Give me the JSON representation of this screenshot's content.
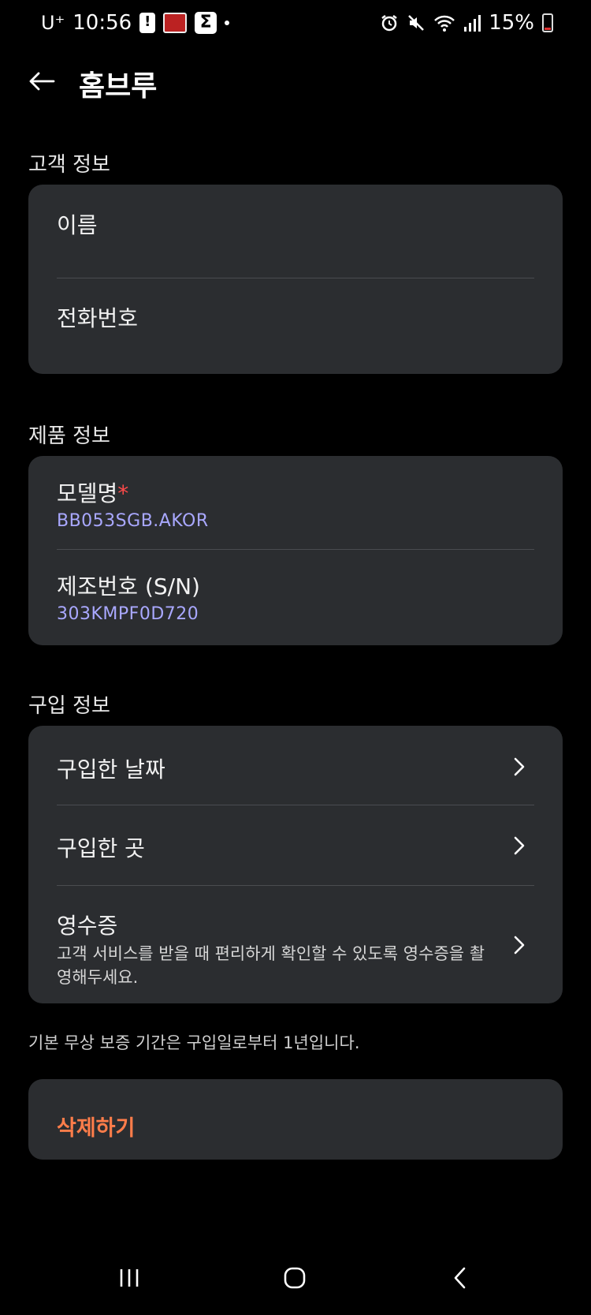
{
  "status_bar": {
    "carrier": "U⁺",
    "time": "10:56",
    "battery": "15%"
  },
  "header": {
    "title": "홈브루"
  },
  "customer": {
    "section_title": "고객 정보",
    "name_label": "이름",
    "phone_label": "전화번호"
  },
  "product": {
    "section_title": "제품 정보",
    "model_label": "모델명",
    "model_required_mark": "*",
    "model_value": "BB053SGB.AKOR",
    "serial_label": "제조번호 (S/N)",
    "serial_value": "303KMPF0D720"
  },
  "purchase": {
    "section_title": "구입 정보",
    "date_label": "구입한 날짜",
    "place_label": "구입한 곳",
    "receipt_label": "영수증",
    "receipt_desc": "고객 서비스를 받을 때 편리하게 확인할 수 있도록 영수증을 촬영해두세요."
  },
  "warranty_note": "기본 무상 보증 기간은 구입일로부터 1년입니다.",
  "delete_label": "삭제하기",
  "colors": {
    "background": "#000000",
    "card": "#2b2d30",
    "value_text": "#a9a8ff",
    "delete_text": "#ff7d4a",
    "required": "#ff4a4a"
  },
  "icons": [
    "back-arrow-icon",
    "chevron-right-icon",
    "recent-apps-icon",
    "home-icon",
    "nav-back-icon"
  ]
}
